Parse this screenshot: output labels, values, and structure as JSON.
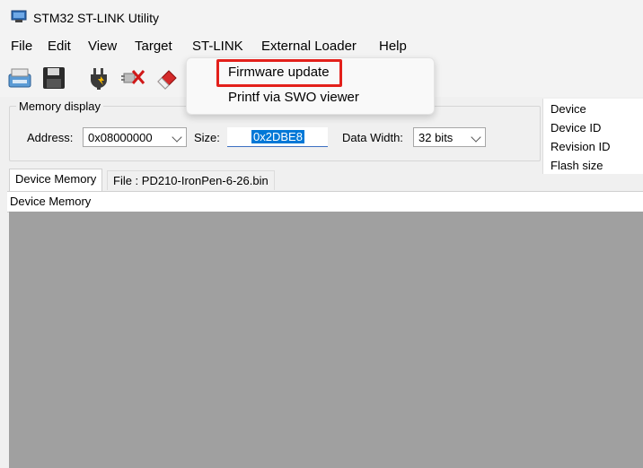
{
  "window": {
    "title": "STM32 ST-LINK Utility"
  },
  "menu": {
    "items": [
      "File",
      "Edit",
      "View",
      "Target",
      "ST-LINK",
      "External Loader",
      "Help"
    ]
  },
  "toolbar": {
    "icons": [
      "save-device-icon",
      "save-file-icon",
      "connect-icon",
      "disconnect-icon",
      "erase-icon"
    ]
  },
  "stlink_menu": {
    "items": [
      "Firmware update",
      "Printf via SWO viewer"
    ],
    "highlight_color": "#e3201b"
  },
  "memory_display": {
    "legend": "Memory display",
    "address_label": "Address:",
    "address_value": "0x08000000",
    "size_label": "Size:",
    "size_value": "0x2DBE8",
    "data_width_label": "Data Width:",
    "data_width_value": "32 bits"
  },
  "device_info": {
    "rows": [
      "Device",
      "Device ID",
      "Revision ID",
      "Flash size"
    ]
  },
  "tabs": [
    "Device Memory",
    "File : PD210-IronPen-6-26.bin"
  ],
  "panel": {
    "header": "Device Memory"
  }
}
